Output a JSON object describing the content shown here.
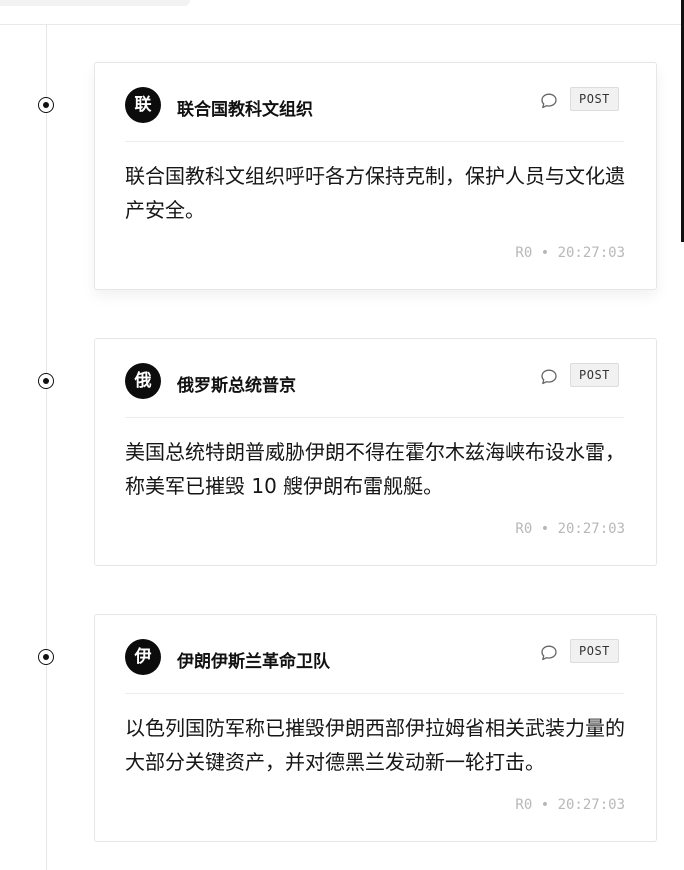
{
  "feed": {
    "entries": [
      {
        "avatar_char": "联",
        "source": "联合国教科文组织",
        "badge": "POST",
        "body": "联合国教科文组织呼吁各方保持克制，保护人员与文化遗产安全。",
        "meta": "R0 • 20:27:03"
      },
      {
        "avatar_char": "俄",
        "source": "俄罗斯总统普京",
        "badge": "POST",
        "body": "美国总统特朗普威胁伊朗不得在霍尔木兹海峡布设水雷，称美军已摧毁 10 艘伊朗布雷舰艇。",
        "meta": "R0 • 20:27:03"
      },
      {
        "avatar_char": "伊",
        "source": "伊朗伊斯兰革命卫队",
        "badge": "POST",
        "body": "以色列国防军称已摧毁伊朗西部伊拉姆省相关武装力量的大部分关键资产，并对德黑兰发动新一轮打击。",
        "meta": "R0 • 20:27:03"
      }
    ]
  },
  "icons": {
    "timeline_marker": "radio-dot-icon",
    "comment": "comment-bubble-icon"
  },
  "colors": {
    "text": "#111111",
    "meta": "#b8b8b8",
    "avatar_bg": "#0c0c0c",
    "badge_bg": "#f1f1f1"
  }
}
